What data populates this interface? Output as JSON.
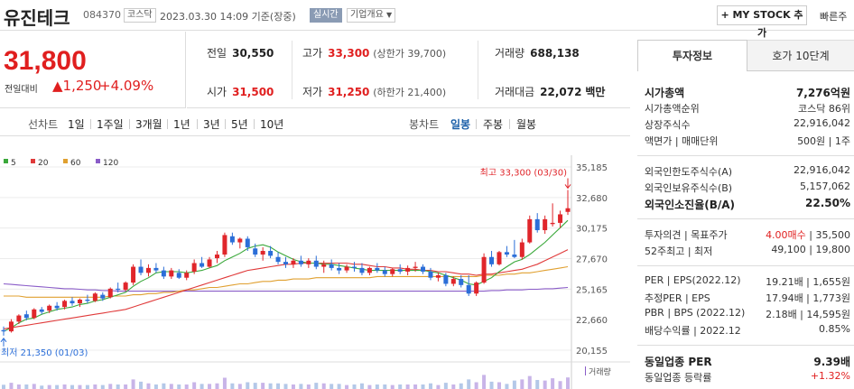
{
  "header": {
    "name": "유진테크",
    "code": "084370",
    "market": "코스닥",
    "datetime": "2023.03.30 14:09 기준(장중)",
    "realtime": "실시간",
    "company_info": "기업개요",
    "mystock": "+ MY STOCK 추가",
    "quick": "빠른주"
  },
  "price": {
    "current": "31,800",
    "change_label": "전일대비",
    "change": "▲1,250",
    "change_pct": "+4.09%"
  },
  "quotes": {
    "prev_label": "전일",
    "prev": "30,550",
    "high_label": "고가",
    "high": "33,300",
    "high_sub": "(상한가 39,700)",
    "volume_label": "거래량",
    "volume": "688,138",
    "open_label": "시가",
    "open": "31,500",
    "low_label": "저가",
    "low": "31,250",
    "low_sub": "(하한가 21,400)",
    "amount_label": "거래대금",
    "amount": "22,072",
    "amount_unit": "백만"
  },
  "period": {
    "line_label": "선차트",
    "line_options": [
      "1일",
      "1주일",
      "3개월",
      "1년",
      "3년",
      "5년",
      "10년"
    ],
    "candle_label": "봉차트",
    "candle_options": [
      "일봉",
      "주봉",
      "월봉"
    ],
    "candle_selected": "일봉"
  },
  "tabs": {
    "invest": "투자정보",
    "hoga": "호가 10단계"
  },
  "invest": [
    {
      "label": "시가총액",
      "value": "7,276억원",
      "bold": true
    },
    {
      "label": "시가총액순위",
      "value": "코스닥 86위"
    },
    {
      "label": "상장주식수",
      "value": "22,916,042"
    },
    {
      "label": "액면가 | 매매단위",
      "value": "500원 | 1주"
    },
    {
      "label": "외국인한도주식수(A)",
      "value": "22,916,042"
    },
    {
      "label": "외국인보유주식수(B)",
      "value": "5,157,062"
    },
    {
      "label": "외국인소진율(B/A)",
      "value": "22.50%",
      "bold": true
    },
    {
      "label": "투자의견 | 목표주가",
      "value_red": "4.00매수",
      "value": "| 35,500"
    },
    {
      "label": "52주최고 | 최저",
      "value": "49,100 | 19,800"
    },
    {
      "label": "PER | EPS(2022.12)",
      "value": "19.21배 | 1,655원"
    },
    {
      "label": "추정PER | EPS",
      "value": "17.94배 | 1,773원"
    },
    {
      "label": "PBR | BPS (2022.12)",
      "value": "2.18배 | 14,595원"
    },
    {
      "label": "배당수익률 | 2022.12",
      "value": "0.85%"
    },
    {
      "label": "동일업종 PER",
      "value": "9.39배",
      "bold": true
    },
    {
      "label": "동일업종 등락률",
      "value": "+1.32%",
      "red": true
    }
  ],
  "chart_data": {
    "type": "candlestick",
    "legend": [
      {
        "name": "5",
        "color": "#3aa83a"
      },
      {
        "name": "20",
        "color": "#e03a3a"
      },
      {
        "name": "60",
        "color": "#e0a030"
      },
      {
        "name": "120",
        "color": "#8a5cc8"
      }
    ],
    "yticks": [
      35185,
      32680,
      30175,
      27670,
      25165,
      22660,
      20155
    ],
    "ylim": [
      20155,
      35185
    ],
    "max_label": "최고 33,300 (03/30)",
    "min_label": "최저 21,350 (01/03)",
    "volume_label": "거래량",
    "candles": [
      [
        21800,
        22100,
        21350,
        21700
      ],
      [
        21700,
        22700,
        21600,
        22500
      ],
      [
        22500,
        23100,
        22300,
        23000
      ],
      [
        23100,
        23400,
        22600,
        22800
      ],
      [
        22800,
        23600,
        22700,
        23500
      ],
      [
        23500,
        23700,
        23100,
        23300
      ],
      [
        23400,
        23900,
        23200,
        23800
      ],
      [
        23800,
        24100,
        23400,
        23600
      ],
      [
        23700,
        24300,
        23500,
        24200
      ],
      [
        24200,
        24500,
        23800,
        24000
      ],
      [
        24000,
        24400,
        23700,
        24300
      ],
      [
        24300,
        24700,
        24000,
        24200
      ],
      [
        24200,
        24900,
        24100,
        24800
      ],
      [
        24700,
        24900,
        24200,
        24400
      ],
      [
        24500,
        25300,
        24400,
        25200
      ],
      [
        25200,
        25700,
        24900,
        25100
      ],
      [
        25100,
        25800,
        25000,
        25700
      ],
      [
        25700,
        27200,
        25500,
        27000
      ],
      [
        27000,
        27600,
        26300,
        26500
      ],
      [
        26500,
        27200,
        26200,
        26900
      ],
      [
        26900,
        27300,
        26500,
        26700
      ],
      [
        26700,
        27000,
        26000,
        26200
      ],
      [
        26200,
        26900,
        26000,
        26700
      ],
      [
        26500,
        26800,
        26000,
        26100
      ],
      [
        26100,
        26700,
        25900,
        26500
      ],
      [
        26600,
        27600,
        26400,
        27300
      ],
      [
        27300,
        27800,
        26900,
        27000
      ],
      [
        27000,
        27800,
        26900,
        27600
      ],
      [
        27700,
        28300,
        27300,
        28000
      ],
      [
        28000,
        29800,
        27800,
        29600
      ],
      [
        29500,
        29800,
        28800,
        29000
      ],
      [
        29000,
        29400,
        28500,
        29300
      ],
      [
        29300,
        29500,
        28300,
        28600
      ],
      [
        28500,
        28900,
        27800,
        28000
      ],
      [
        28000,
        28600,
        27500,
        28300
      ],
      [
        28300,
        28700,
        27700,
        27900
      ],
      [
        27800,
        28200,
        27200,
        27400
      ],
      [
        27400,
        27800,
        26900,
        27200
      ],
      [
        27200,
        27700,
        26900,
        27500
      ],
      [
        27500,
        27900,
        27000,
        27200
      ],
      [
        27200,
        27700,
        26900,
        27500
      ],
      [
        27500,
        27900,
        26800,
        27000
      ],
      [
        27000,
        27500,
        26500,
        27200
      ],
      [
        27200,
        27600,
        26700,
        26900
      ],
      [
        26900,
        27300,
        26400,
        26700
      ],
      [
        26700,
        27200,
        26500,
        27000
      ],
      [
        27000,
        27400,
        26600,
        26900
      ],
      [
        26900,
        27300,
        26300,
        26500
      ],
      [
        26500,
        27000,
        26300,
        26900
      ],
      [
        26900,
        27300,
        26500,
        26700
      ],
      [
        26700,
        27000,
        26200,
        26400
      ],
      [
        26400,
        26900,
        26200,
        26800
      ],
      [
        26800,
        27200,
        26400,
        26600
      ],
      [
        26600,
        27100,
        26300,
        26900
      ],
      [
        26900,
        27400,
        26600,
        27000
      ],
      [
        27000,
        27200,
        26400,
        26600
      ],
      [
        26600,
        26900,
        25900,
        26100
      ],
      [
        26100,
        26500,
        25800,
        26300
      ],
      [
        26300,
        26500,
        25400,
        25600
      ],
      [
        25600,
        26200,
        25400,
        26000
      ],
      [
        26000,
        26300,
        25300,
        25500
      ],
      [
        25500,
        26300,
        24600,
        24800
      ],
      [
        24800,
        25800,
        24600,
        25700
      ],
      [
        25700,
        28100,
        25600,
        27800
      ],
      [
        27800,
        28300,
        27000,
        27200
      ],
      [
        27200,
        28300,
        27100,
        28200
      ],
      [
        28200,
        28700,
        27800,
        28000
      ],
      [
        28000,
        29200,
        27700,
        27800
      ],
      [
        27800,
        29300,
        27600,
        29000
      ],
      [
        29000,
        31200,
        28900,
        30900
      ],
      [
        30900,
        31400,
        29800,
        30000
      ],
      [
        30000,
        31200,
        29700,
        30900
      ],
      [
        30500,
        32200,
        30300,
        30600
      ],
      [
        30600,
        31600,
        30200,
        31300
      ],
      [
        31500,
        33300,
        31250,
        31800
      ]
    ],
    "ma5": [
      21700,
      22000,
      22400,
      22700,
      22800,
      23100,
      23300,
      23500,
      23600,
      23700,
      23900,
      24000,
      24200,
      24300,
      24500,
      24700,
      24900,
      25400,
      25800,
      26100,
      26500,
      26600,
      26600,
      26600,
      26500,
      26600,
      26700,
      26900,
      27100,
      27500,
      27800,
      28100,
      28500,
      28700,
      28800,
      28600,
      28200,
      27900,
      27600,
      27400,
      27300,
      27300,
      27200,
      27200,
      27100,
      27000,
      26900,
      26800,
      26700,
      26700,
      26700,
      26700,
      26700,
      26700,
      26700,
      26700,
      26600,
      26500,
      26300,
      26100,
      25900,
      25600,
      25500,
      25800,
      26100,
      26600,
      27000,
      27400,
      27600,
      28000,
      28500,
      29000,
      29600,
      30200,
      30800
    ],
    "ma20": [
      21900,
      22000,
      22100,
      22200,
      22300,
      22400,
      22500,
      22600,
      22700,
      22800,
      22900,
      23000,
      23100,
      23200,
      23300,
      23400,
      23500,
      23700,
      23900,
      24100,
      24300,
      24500,
      24700,
      24900,
      25100,
      25300,
      25500,
      25700,
      25900,
      26100,
      26300,
      26500,
      26700,
      26800,
      26900,
      27000,
      27100,
      27200,
      27200,
      27300,
      27300,
      27300,
      27300,
      27300,
      27300,
      27300,
      27200,
      27200,
      27100,
      27000,
      27000,
      26900,
      26900,
      26800,
      26800,
      26700,
      26700,
      26600,
      26600,
      26500,
      26400,
      26400,
      26300,
      26400,
      26400,
      26500,
      26600,
      26700,
      26800,
      27000,
      27200,
      27500,
      27800,
      28100,
      28400
    ],
    "ma60": [
      24600,
      24600,
      24600,
      24500,
      24500,
      24500,
      24500,
      24500,
      24500,
      24500,
      24500,
      24500,
      24500,
      24500,
      24600,
      24600,
      24600,
      24700,
      24700,
      24800,
      24800,
      24900,
      24900,
      25000,
      25100,
      25100,
      25200,
      25300,
      25300,
      25400,
      25500,
      25600,
      25600,
      25700,
      25800,
      25800,
      25900,
      25900,
      26000,
      26000,
      26000,
      26100,
      26100,
      26100,
      26100,
      26100,
      26100,
      26100,
      26100,
      26200,
      26200,
      26200,
      26200,
      26200,
      26200,
      26200,
      26200,
      26200,
      26200,
      26200,
      26200,
      26200,
      26200,
      26300,
      26300,
      26300,
      26400,
      26400,
      26500,
      26500,
      26600,
      26700,
      26800,
      26900,
      27000
    ],
    "ma120": [
      25600,
      25550,
      25500,
      25450,
      25400,
      25350,
      25300,
      25250,
      25200,
      25200,
      25150,
      25100,
      25100,
      25050,
      25050,
      25000,
      25000,
      25000,
      25000,
      25000,
      25000,
      25000,
      25000,
      25000,
      25000,
      25000,
      25000,
      25000,
      25000,
      25000,
      25000,
      25000,
      25000,
      25000,
      25000,
      25000,
      25000,
      25000,
      25000,
      25000,
      25000,
      25000,
      25000,
      25000,
      25000,
      25000,
      25000,
      25000,
      25000,
      25000,
      25000,
      25000,
      25000,
      25000,
      25000,
      25000,
      25000,
      25000,
      25000,
      25000,
      25000,
      25000,
      25000,
      25000,
      25050,
      25050,
      25100,
      25100,
      25100,
      25150,
      25150,
      25200,
      25200,
      25250,
      25300
    ]
  }
}
